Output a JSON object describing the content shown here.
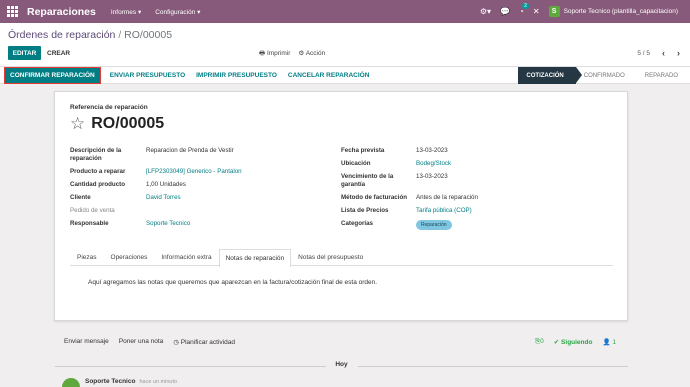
{
  "navbar": {
    "app_name": "Reparaciones",
    "menus": [
      "Informes ▾",
      "Configuración ▾"
    ],
    "user": "Soporte Tecnico (plantilla_capacitacion)",
    "user_initial": "S",
    "badge": "2"
  },
  "breadcrumb": {
    "parent": "Órdenes de reparación",
    "sep": "/",
    "current": "RO/00005"
  },
  "buttons": {
    "edit": "EDITAR",
    "create": "CREAR",
    "print": "Imprimir",
    "action": "Acción"
  },
  "pager": {
    "value": "5 / 5"
  },
  "statusbar": {
    "confirm": "CONFIRMAR REPARACIÓN",
    "send_quote": "ENVIAR PRESUPUESTO",
    "print_quote": "IMPRIMIR PRESUPUESTO",
    "cancel": "CANCELAR REPARACIÓN",
    "stages": [
      "COTIZACIÓN",
      "CONFIRMADO",
      "REPARADO"
    ]
  },
  "form": {
    "ref_label": "Referencia de reparación",
    "title": "RO/00005",
    "left": [
      {
        "label": "Descripción de la reparación",
        "value": "Reparacion de Prenda de Vestir",
        "link": false
      },
      {
        "label": "Producto a reparar",
        "value": "[LFP2303049] Generico - Pantalon",
        "link": true
      },
      {
        "label": "Cantidad producto",
        "value": "1,00 Unidades",
        "link": false
      },
      {
        "label": "Cliente",
        "value": "David Torres",
        "link": true
      },
      {
        "label": "Pedido de venta",
        "value": "",
        "link": false
      },
      {
        "label": "Responsable",
        "value": "Soporte Tecnico",
        "link": true
      }
    ],
    "right": [
      {
        "label": "Fecha prevista",
        "value": "13-03-2023",
        "link": false
      },
      {
        "label": "Ubicación",
        "value": "Bodeg/Stock",
        "link": true
      },
      {
        "label": "Vencimiento de la garantía",
        "value": "13-03-2023",
        "link": false
      },
      {
        "label": "Método de facturación",
        "value": "Antes de la reparación",
        "link": false
      },
      {
        "label": "Lista de Precios",
        "value": "Tarifa pública (COP)",
        "link": true
      },
      {
        "label": "Categorías",
        "value": "Reparación",
        "link": false
      }
    ]
  },
  "tabs": [
    "Piezas",
    "Operaciones",
    "Información extra",
    "Notas de reparación",
    "Notas del presupuesto"
  ],
  "notes": "Aquí agregamos las notas que queremos que aparezcan en la factura/cotización final de esta orden.",
  "chatter": {
    "send_message": "Enviar mensaje",
    "log_note": "Poner una nota",
    "schedule": "Planificar actividad",
    "attachments": "0",
    "following": "Siguiendo",
    "followers": "1",
    "day": "Hoy",
    "author": "Soporte Tecnico",
    "time": "hace un minuto"
  },
  "colors": {
    "navbar": "#875a7b",
    "primary": "#017e84",
    "highlight": "#e53935",
    "stage_active": "#243742"
  }
}
